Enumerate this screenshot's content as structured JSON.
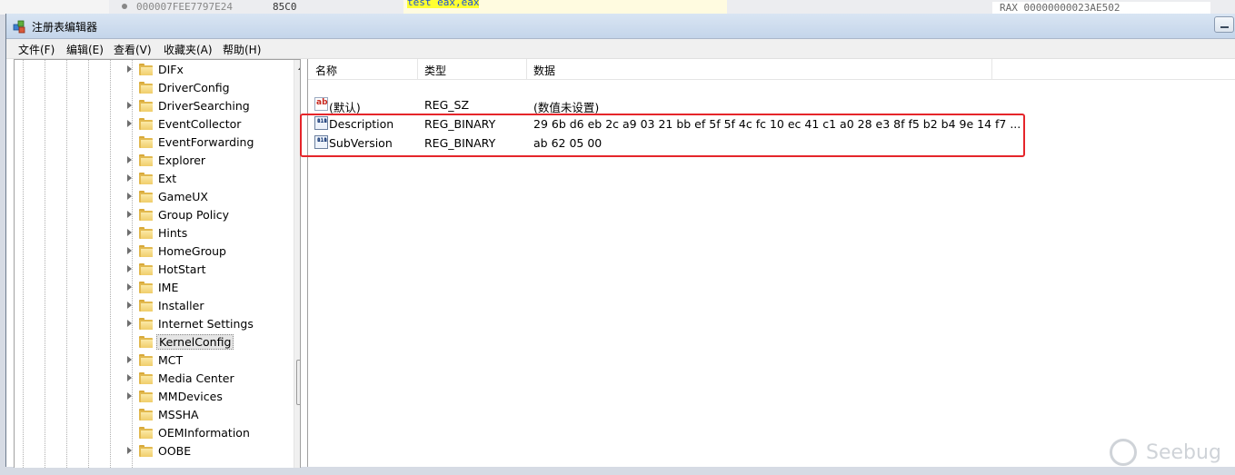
{
  "background": {
    "address": "000007FEE7797E24",
    "hex": "85C0",
    "code_line1": "test eax,eax",
    "register": "RAX 00000000023AE502"
  },
  "window": {
    "title": "注册表编辑器",
    "icon": "regedit-icon"
  },
  "menu": [
    "文件(F)",
    "编辑(E)",
    "查看(V)",
    "收藏夹(A)",
    "帮助(H)"
  ],
  "tree": {
    "items": [
      {
        "label": "DIFx",
        "expandable": true
      },
      {
        "label": "DriverConfig",
        "expandable": false
      },
      {
        "label": "DriverSearching",
        "expandable": true
      },
      {
        "label": "EventCollector",
        "expandable": true
      },
      {
        "label": "EventForwarding",
        "expandable": false
      },
      {
        "label": "Explorer",
        "expandable": true
      },
      {
        "label": "Ext",
        "expandable": true
      },
      {
        "label": "GameUX",
        "expandable": true
      },
      {
        "label": "Group Policy",
        "expandable": true
      },
      {
        "label": "Hints",
        "expandable": true
      },
      {
        "label": "HomeGroup",
        "expandable": true
      },
      {
        "label": "HotStart",
        "expandable": true
      },
      {
        "label": "IME",
        "expandable": true
      },
      {
        "label": "Installer",
        "expandable": true
      },
      {
        "label": "Internet Settings",
        "expandable": true
      },
      {
        "label": "KernelConfig",
        "expandable": false,
        "selected": true
      },
      {
        "label": "MCT",
        "expandable": true
      },
      {
        "label": "Media Center",
        "expandable": true
      },
      {
        "label": "MMDevices",
        "expandable": true
      },
      {
        "label": "MSSHA",
        "expandable": false
      },
      {
        "label": "OEMInformation",
        "expandable": false
      },
      {
        "label": "OOBE",
        "expandable": true
      }
    ]
  },
  "list": {
    "columns": [
      "名称",
      "类型",
      "数据"
    ],
    "rows": [
      {
        "icon": "string-value-icon",
        "name": "(默认)",
        "type": "REG_SZ",
        "data": "(数值未设置)"
      },
      {
        "icon": "binary-value-icon",
        "name": "Description",
        "type": "REG_BINARY",
        "data": "29 6b d6 eb 2c a9 03 21 bb ef 5f 5f 4c fc 10 ec 41 c1 a0 28 e3 8f f5 b2 b4 9e 14 f7 ..."
      },
      {
        "icon": "binary-value-icon",
        "name": "SubVersion",
        "type": "REG_BINARY",
        "data": "ab 62 05 00"
      }
    ]
  },
  "icon_text": {
    "string_value": "ab",
    "binary_value_line1": "011",
    "binary_value_line2": "110"
  },
  "watermark": "Seebug",
  "colors": {
    "highlight_box": "#e5252a",
    "folder": "#e2b94f"
  }
}
